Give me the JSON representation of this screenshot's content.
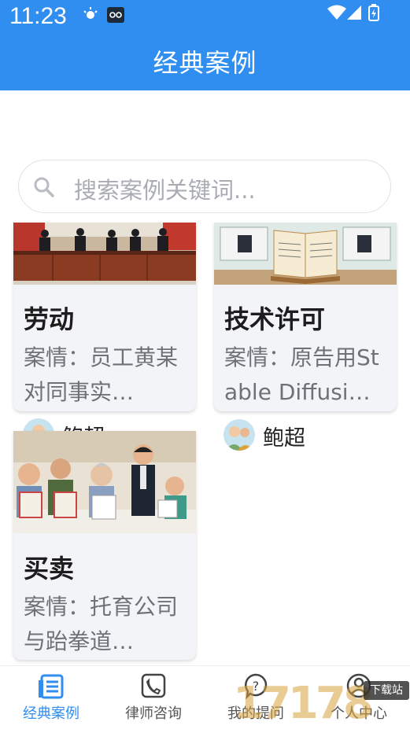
{
  "status_bar": {
    "time": "11:23"
  },
  "header": {
    "title": "经典案例"
  },
  "search": {
    "placeholder": "搜索案例关键词..."
  },
  "cases": [
    {
      "title": "劳动",
      "desc": "案情：员工黄某对同事实…",
      "author": "鲍超"
    },
    {
      "title": "技术许可",
      "desc": "案情：原告用Stable Diffusi…",
      "author": "鲍超"
    },
    {
      "title": "买卖",
      "desc": "案情：托育公司与跆拳道…"
    }
  ],
  "tabbar": {
    "items": [
      {
        "label": "经典案例",
        "icon": "list-icon",
        "active": true
      },
      {
        "label": "律师咨询",
        "icon": "phone-icon",
        "active": false
      },
      {
        "label": "我的提问",
        "icon": "question-icon",
        "active": false
      },
      {
        "label": "个人中心",
        "icon": "user-icon",
        "active": false
      }
    ]
  },
  "watermark": {
    "text": "17178",
    "badge": "下载站"
  },
  "colors": {
    "primary": "#2f8ef0",
    "card_bg": "#f3f4f8",
    "muted": "#6f7177"
  }
}
